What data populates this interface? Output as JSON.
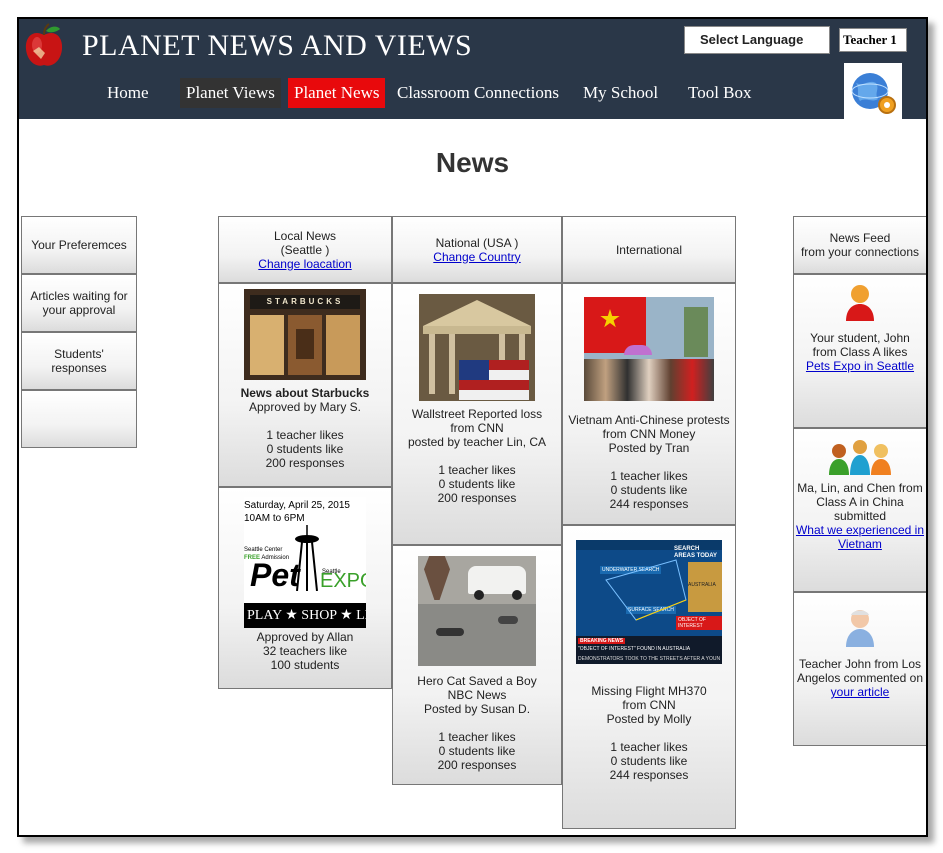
{
  "site": {
    "title": "PLANET NEWS AND VIEWS",
    "language_select": "Select Language",
    "user_select": "Teacher 1"
  },
  "nav": {
    "home": "Home",
    "planet_views": "Planet Views",
    "planet_news": "Planet News",
    "classroom": "Classroom Connections",
    "my_school": "My School",
    "tool_box": "Tool Box"
  },
  "page_heading": "News",
  "left_menu": [
    "Your Preferemces",
    "Articles waiting for your approval",
    "Students' responses",
    ""
  ],
  "columns": {
    "local": {
      "title": "Local News",
      "sub": "(Seattle )",
      "link": "Change loacation"
    },
    "national": {
      "title": "National (USA )",
      "link": "Change Country"
    },
    "international": {
      "title": "International"
    }
  },
  "cards": {
    "starbucks": {
      "headline": "News about Starbucks",
      "approved": "Approved by Mary S.",
      "teacher_likes": "1 teacher likes",
      "student_likes": "0 students like",
      "responses": "200 responses",
      "sign_text": "STARBUCKS"
    },
    "petexpo": {
      "approved": "Approved by Allan",
      "teacher_likes": "32 teachers like",
      "student_likes": "100 students",
      "poster_date": "Saturday, April 25, 2015",
      "poster_time": "10AM to 6PM",
      "poster_venue": "Seattle Center",
      "poster_free": "FREE",
      "poster_admission": "Admission",
      "poster_pet": "Pet",
      "poster_seattle": "Seattle",
      "poster_expo": "EXPO",
      "poster_bottom": "PLAY ★ SHOP ★ LE"
    },
    "wallstreet": {
      "line1": "Wallstreet Reported loss",
      "line2": "from CNN",
      "line3": "posted by teacher Lin, CA",
      "teacher_likes": "1 teacher likes",
      "student_likes": "0 students like",
      "responses": "200 responses"
    },
    "herocat": {
      "line1": "Hero Cat Saved a Boy",
      "line2": "NBC News",
      "line3": "Posted by Susan D.",
      "teacher_likes": "1 teacher likes",
      "student_likes": "0 students like",
      "responses": "200 responses"
    },
    "vietnam": {
      "line1": "Vietnam Anti-Chinese protests",
      "line2": "from CNN Money",
      "line3": "Posted by Tran",
      "teacher_likes": "1 teacher likes",
      "student_likes": "0 students like",
      "responses": "244 responses"
    },
    "mh370": {
      "line1": "Missing Flight MH370",
      "line2": "from CNN",
      "line3": "Posted by Molly",
      "teacher_likes": "1 teacher likes",
      "student_likes": "0 students like",
      "responses": "244 responses",
      "map_label1": "SEARCH AREAS TODAY",
      "map_label2": "UNDERWATER SEARCH",
      "map_label3": "SURFACE SEARCH",
      "map_label4": "OBJECT OF INTEREST",
      "map_label5": "AUSTRALIA",
      "ticker1": "BREAKING NEWS",
      "ticker2": "\"OBJECT OF INTEREST\" FOUND IN AUSTRALIA",
      "ticker3": "DEMONSTRATORS TOOK TO THE STREETS AFTER A YOUNG"
    }
  },
  "feed": {
    "header_line1": "News Feed",
    "header_line2": "from your connections",
    "item1": {
      "text": "Your student, John from Class A likes",
      "link": "Pets Expo in Seattle"
    },
    "item2": {
      "text": "Ma, Lin, and Chen from Class A in China submitted",
      "link": "What we experienced in Vietnam"
    },
    "item3": {
      "text": "Teacher John from Los Angelos commented on",
      "link": "your article"
    }
  },
  "colors": {
    "header_bg": "#2a3748",
    "active_tab": "#e8090c",
    "link": "#0000cc"
  }
}
